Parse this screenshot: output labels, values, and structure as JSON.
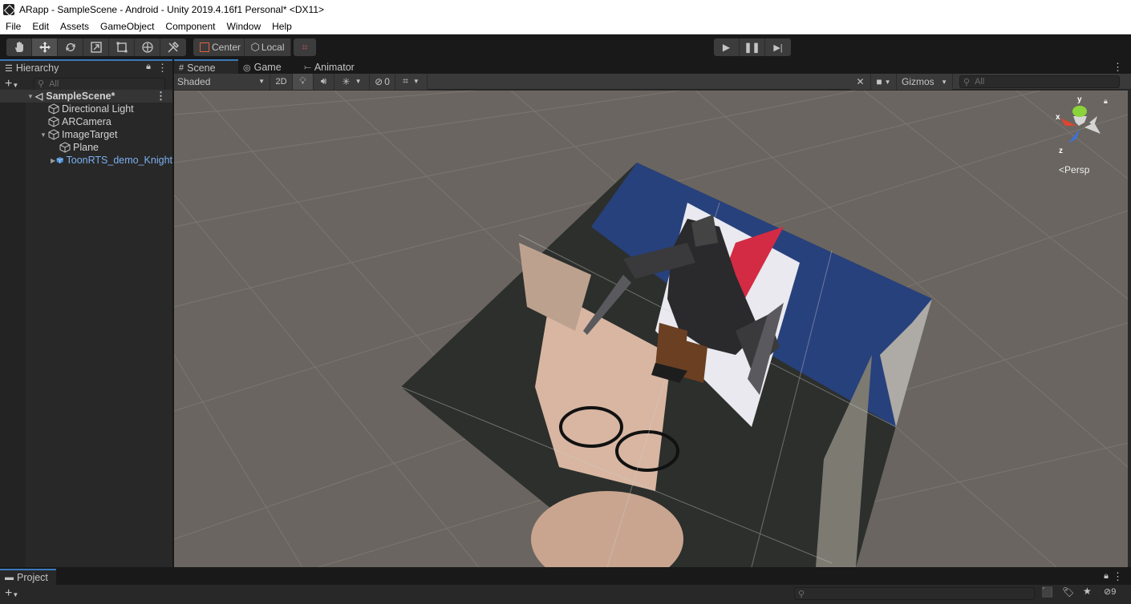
{
  "window": {
    "title": "ARapp - SampleScene - Android - Unity 2019.4.16f1 Personal* <DX11>"
  },
  "menu": {
    "items": [
      "File",
      "Edit",
      "Assets",
      "GameObject",
      "Component",
      "Window",
      "Help"
    ]
  },
  "toolbar": {
    "tools": [
      "hand-tool-icon",
      "move-tool-icon",
      "rotate-tool-icon",
      "scale-tool-icon",
      "rect-tool-icon",
      "transform-tool-icon",
      "custom-tool-icon"
    ],
    "active_tool": "move-tool-icon",
    "pivot_label": "Center",
    "space_label": "Local",
    "snap_icon": "grid-snap-icon",
    "play_icons": [
      "play-icon",
      "pause-icon",
      "step-icon"
    ]
  },
  "hierarchy": {
    "tab_label": "Hierarchy",
    "search_placeholder": "All",
    "scene_name": "SampleScene*",
    "items": [
      {
        "label": "Directional Light",
        "depth": 1,
        "expandable": false,
        "prefab": false
      },
      {
        "label": "ARCamera",
        "depth": 1,
        "expandable": false,
        "prefab": false
      },
      {
        "label": "ImageTarget",
        "depth": 1,
        "expandable": true,
        "expanded": true,
        "prefab": false
      },
      {
        "label": "Plane",
        "depth": 2,
        "expandable": false,
        "prefab": false
      },
      {
        "label": "ToonRTS_demo_Knight",
        "depth": 2,
        "expandable": true,
        "expanded": false,
        "prefab": true
      }
    ]
  },
  "scene": {
    "tabs": [
      {
        "label": "Scene",
        "icon": "grid-icon",
        "active": true
      },
      {
        "label": "Game",
        "icon": "gamepad-icon",
        "active": false
      },
      {
        "label": "Animator",
        "icon": "animator-icon",
        "active": false
      }
    ],
    "shading_mode": "Shaded",
    "mode_2d_label": "2D",
    "hidden_count": "0",
    "gizmos_label": "Gizmos",
    "search_placeholder": "All",
    "projection_label": "Persp",
    "axis_labels": {
      "x": "x",
      "y": "y",
      "z": "z"
    }
  },
  "project": {
    "tab_label": "Project",
    "hidden_count": "9"
  }
}
